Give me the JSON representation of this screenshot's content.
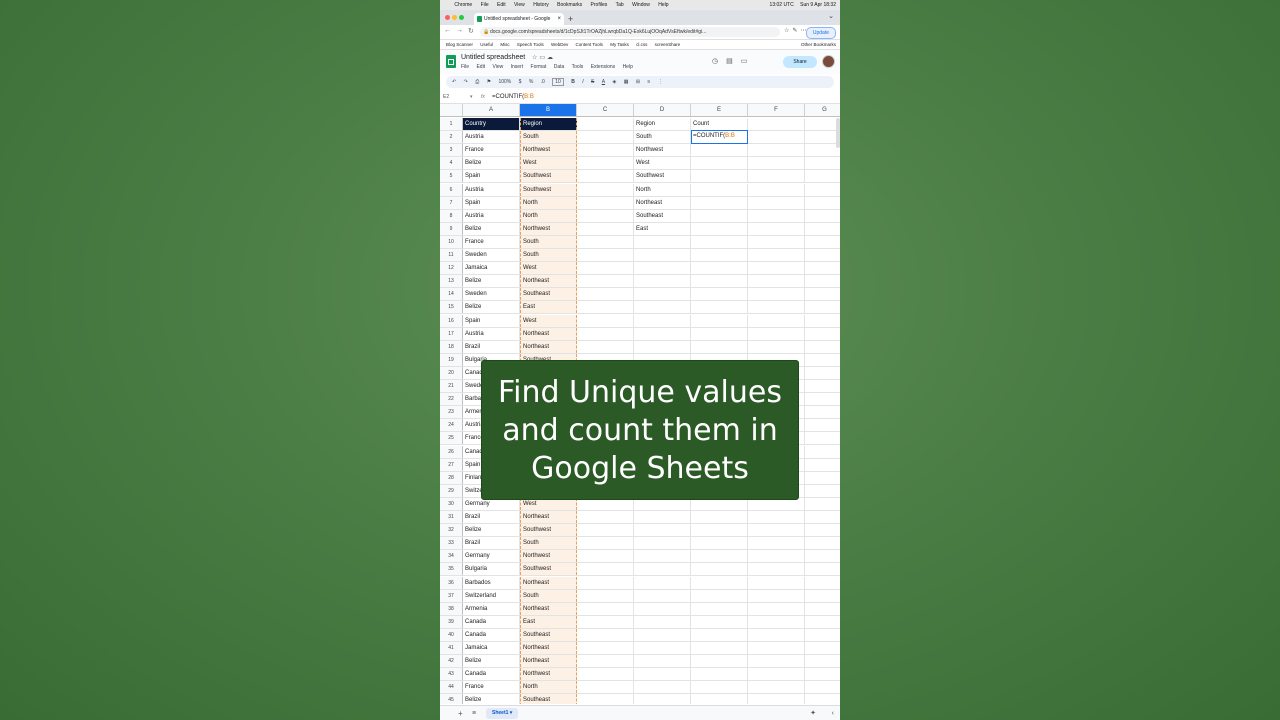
{
  "menubar": {
    "app": "Chrome",
    "items": [
      "File",
      "Edit",
      "View",
      "History",
      "Bookmarks",
      "Profiles",
      "Tab",
      "Window",
      "Help"
    ],
    "clock_utc": "13:02 UTC",
    "date_time": "Sun 9 Apr  18:32"
  },
  "browser": {
    "tab_title": "Untitled spreadsheet - Google",
    "url": "docs.google.com/spreadsheets/d/1cDpSJt1TrOAZjhLwrqbDa1Q-Exk6LujOOqAdVsEftwk/edit#gi...",
    "update_label": "Update",
    "bookmarks": [
      "Blog Scanner",
      "Useful",
      "Misc",
      "Speech Tools",
      "WebDev",
      "Content Tools",
      "My Tasks",
      "cl.css",
      "screenShare"
    ],
    "other_bookmarks": "Other Bookmarks"
  },
  "sheets": {
    "doc_title": "Untitled spreadsheet",
    "menus": [
      "File",
      "Edit",
      "View",
      "Insert",
      "Format",
      "Data",
      "Tools",
      "Extensions",
      "Help"
    ],
    "share_label": "Share",
    "zoom": "100%",
    "font_size": "10",
    "name_box": "E2",
    "formula_prefix": "=COUNTIF(",
    "formula_ref": "B:B",
    "sheet_tab": "Sheet1"
  },
  "columns": [
    "A",
    "B",
    "C",
    "D",
    "E",
    "F",
    "G"
  ],
  "rows": [
    {
      "n": "1",
      "a": "Country",
      "b": "Region",
      "d": "Region",
      "e": "Count"
    },
    {
      "n": "2",
      "a": "Austria",
      "b": "South",
      "d": "South",
      "e": ""
    },
    {
      "n": "3",
      "a": "France",
      "b": "Northwest",
      "d": "Northwest",
      "e": ""
    },
    {
      "n": "4",
      "a": "Belize",
      "b": "West",
      "d": "West",
      "e": ""
    },
    {
      "n": "5",
      "a": "Spain",
      "b": "Southwest",
      "d": "Southwest",
      "e": ""
    },
    {
      "n": "6",
      "a": "Austria",
      "b": "Southwest",
      "d": "North",
      "e": ""
    },
    {
      "n": "7",
      "a": "Spain",
      "b": "North",
      "d": "Northeast",
      "e": ""
    },
    {
      "n": "8",
      "a": "Austria",
      "b": "North",
      "d": "Southeast",
      "e": ""
    },
    {
      "n": "9",
      "a": "Belize",
      "b": "Northwest",
      "d": "East",
      "e": ""
    },
    {
      "n": "10",
      "a": "France",
      "b": "South",
      "d": "",
      "e": ""
    },
    {
      "n": "11",
      "a": "Sweden",
      "b": "South",
      "d": "",
      "e": ""
    },
    {
      "n": "12",
      "a": "Jamaica",
      "b": "West",
      "d": "",
      "e": ""
    },
    {
      "n": "13",
      "a": "Belize",
      "b": "Northeast",
      "d": "",
      "e": ""
    },
    {
      "n": "14",
      "a": "Sweden",
      "b": "Southeast",
      "d": "",
      "e": ""
    },
    {
      "n": "15",
      "a": "Belize",
      "b": "East",
      "d": "",
      "e": ""
    },
    {
      "n": "16",
      "a": "Spain",
      "b": "West",
      "d": "",
      "e": ""
    },
    {
      "n": "17",
      "a": "Austria",
      "b": "Northeast",
      "d": "",
      "e": ""
    },
    {
      "n": "18",
      "a": "Brazil",
      "b": "Northeast",
      "d": "",
      "e": ""
    },
    {
      "n": "19",
      "a": "Bulgaria",
      "b": "Southwest",
      "d": "",
      "e": ""
    },
    {
      "n": "20",
      "a": "Canada",
      "b": "",
      "d": "",
      "e": ""
    },
    {
      "n": "21",
      "a": "Sweden",
      "b": "",
      "d": "",
      "e": ""
    },
    {
      "n": "22",
      "a": "Barbados",
      "b": "",
      "d": "",
      "e": ""
    },
    {
      "n": "23",
      "a": "Armenia",
      "b": "",
      "d": "",
      "e": ""
    },
    {
      "n": "24",
      "a": "Austria",
      "b": "",
      "d": "",
      "e": ""
    },
    {
      "n": "25",
      "a": "France",
      "b": "",
      "d": "",
      "e": ""
    },
    {
      "n": "26",
      "a": "Canada",
      "b": "",
      "d": "",
      "e": ""
    },
    {
      "n": "27",
      "a": "Spain",
      "b": "",
      "d": "",
      "e": ""
    },
    {
      "n": "28",
      "a": "Finland",
      "b": "",
      "d": "",
      "e": ""
    },
    {
      "n": "29",
      "a": "Switzerland",
      "b": "",
      "d": "",
      "e": ""
    },
    {
      "n": "30",
      "a": "Germany",
      "b": "West",
      "d": "",
      "e": ""
    },
    {
      "n": "31",
      "a": "Brazil",
      "b": "Northeast",
      "d": "",
      "e": ""
    },
    {
      "n": "32",
      "a": "Belize",
      "b": "Southwest",
      "d": "",
      "e": ""
    },
    {
      "n": "33",
      "a": "Brazil",
      "b": "South",
      "d": "",
      "e": ""
    },
    {
      "n": "34",
      "a": "Germany",
      "b": "Northwest",
      "d": "",
      "e": ""
    },
    {
      "n": "35",
      "a": "Bulgaria",
      "b": "Southwest",
      "d": "",
      "e": ""
    },
    {
      "n": "36",
      "a": "Barbados",
      "b": "Northeast",
      "d": "",
      "e": ""
    },
    {
      "n": "37",
      "a": "Switzerland",
      "b": "South",
      "d": "",
      "e": ""
    },
    {
      "n": "38",
      "a": "Armenia",
      "b": "Northeast",
      "d": "",
      "e": ""
    },
    {
      "n": "39",
      "a": "Canada",
      "b": "East",
      "d": "",
      "e": ""
    },
    {
      "n": "40",
      "a": "Canada",
      "b": "Southeast",
      "d": "",
      "e": ""
    },
    {
      "n": "41",
      "a": "Jamaica",
      "b": "Northeast",
      "d": "",
      "e": ""
    },
    {
      "n": "42",
      "a": "Belize",
      "b": "Northeast",
      "d": "",
      "e": ""
    },
    {
      "n": "43",
      "a": "Canada",
      "b": "Northwest",
      "d": "",
      "e": ""
    },
    {
      "n": "44",
      "a": "France",
      "b": "North",
      "d": "",
      "e": ""
    },
    {
      "n": "45",
      "a": "Belize",
      "b": "Southeast",
      "d": "",
      "e": ""
    }
  ],
  "overlay": {
    "line1": "Find Unique values",
    "line2": "and count them in",
    "line3": "Google Sheets"
  },
  "colors": {
    "background": "#4b7e45",
    "overlay": "#2b5a26",
    "header_fill": "#0b1a3a",
    "selected_column": "#1a73e8",
    "range_fill": "#fdf1e5"
  }
}
